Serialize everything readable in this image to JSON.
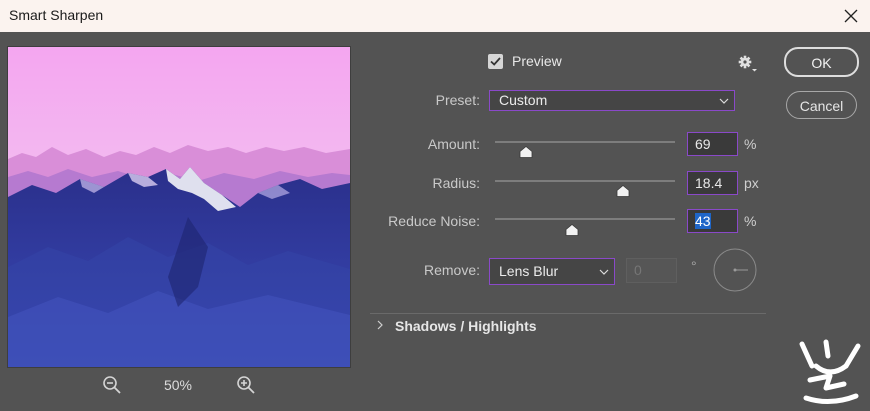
{
  "window": {
    "title": "Smart Sharpen"
  },
  "preview": {
    "label": "Preview",
    "checked": true,
    "zoom": "50%"
  },
  "buttons": {
    "ok": "OK",
    "cancel": "Cancel"
  },
  "preset": {
    "label": "Preset:",
    "value": "Custom"
  },
  "amount": {
    "label": "Amount:",
    "value": "69",
    "unit": "%",
    "slider_fraction": 0.17
  },
  "radius": {
    "label": "Radius:",
    "value": "18.4",
    "unit": "px",
    "slider_fraction": 0.71
  },
  "reduce_noise": {
    "label": "Reduce Noise:",
    "value": "43",
    "unit": "%",
    "slider_fraction": 0.43
  },
  "remove": {
    "label": "Remove:",
    "value": "Lens Blur",
    "angle": "0",
    "angle_unit": "°"
  },
  "shadows_highlights": {
    "label": "Shadows / Highlights"
  },
  "colors": {
    "accent": "#8a49c9",
    "selection": "#1f66c8",
    "panel": "#535353"
  },
  "icons": [
    "close-icon",
    "zoom-out-icon",
    "zoom-in-icon",
    "check-icon",
    "gear-icon",
    "chevron-down-icon",
    "chevron-right-icon",
    "angle-dial-icon",
    "logo-icon"
  ]
}
